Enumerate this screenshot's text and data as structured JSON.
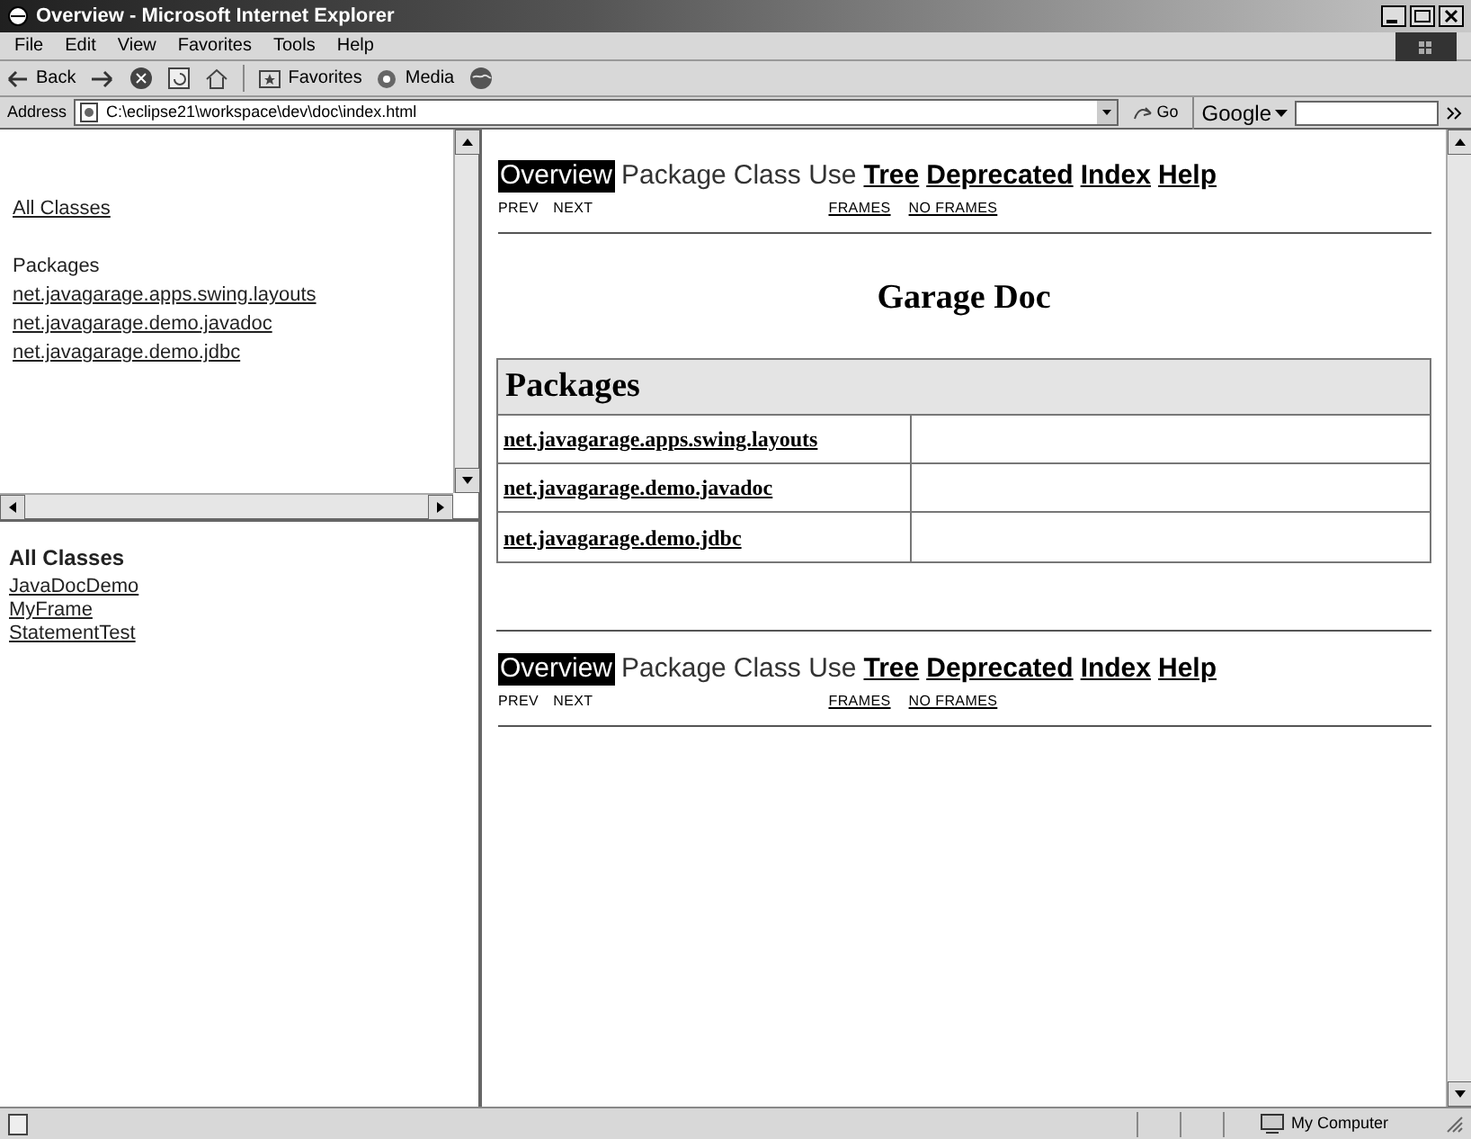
{
  "window": {
    "title": "Overview - Microsoft Internet Explorer"
  },
  "menu": [
    "File",
    "Edit",
    "View",
    "Favorites",
    "Tools",
    "Help"
  ],
  "toolbar": {
    "back": "Back",
    "favorites": "Favorites",
    "media": "Media"
  },
  "address": {
    "label": "Address",
    "value": "C:\\eclipse21\\workspace\\dev\\doc\\index.html",
    "go": "Go",
    "search": "Google"
  },
  "packages_frame": {
    "all_classes": "All Classes",
    "heading": "Packages",
    "packages": [
      "net.javagarage.apps.swing.layouts",
      "net.javagarage.demo.javadoc",
      "net.javagarage.demo.jdbc"
    ]
  },
  "classes_frame": {
    "heading": "All Classes",
    "classes": [
      "JavaDocDemo",
      "MyFrame",
      "StatementTest"
    ]
  },
  "nav_bars": [
    {
      "items": [
        {
          "label": "Overview",
          "selected": true,
          "link": false
        },
        {
          "label": "Package",
          "selected": false,
          "link": false
        },
        {
          "label": "Class Use",
          "selected": false,
          "link": false
        },
        {
          "label": "Tree",
          "selected": false,
          "link": true
        },
        {
          "label": "Deprecated",
          "selected": false,
          "link": true
        },
        {
          "label": "Index",
          "selected": false,
          "link": true
        },
        {
          "label": "Help",
          "selected": false,
          "link": true
        }
      ],
      "prev": "PREV",
      "next": "NEXT",
      "frames": "FRAMES",
      "no_frames": "NO FRAMES"
    },
    {
      "items": [
        {
          "label": "Overview",
          "selected": true,
          "link": false
        },
        {
          "label": "Package",
          "selected": false,
          "link": false
        },
        {
          "label": "Class Use",
          "selected": false,
          "link": false
        },
        {
          "label": "Tree",
          "selected": false,
          "link": true
        },
        {
          "label": "Deprecated",
          "selected": false,
          "link": true
        },
        {
          "label": "Index",
          "selected": false,
          "link": true
        },
        {
          "label": "Help",
          "selected": false,
          "link": true
        }
      ],
      "prev": "PREV",
      "next": "NEXT",
      "frames": "FRAMES",
      "no_frames": "NO FRAMES"
    }
  ],
  "doc_title": "Garage Doc",
  "packages_table": {
    "heading": "Packages",
    "rows": [
      "net.javagarage.apps.swing.layouts",
      "net.javagarage.demo.javadoc",
      "net.javagarage.demo.jdbc"
    ]
  },
  "status_bar": {
    "zone": "My Computer"
  }
}
